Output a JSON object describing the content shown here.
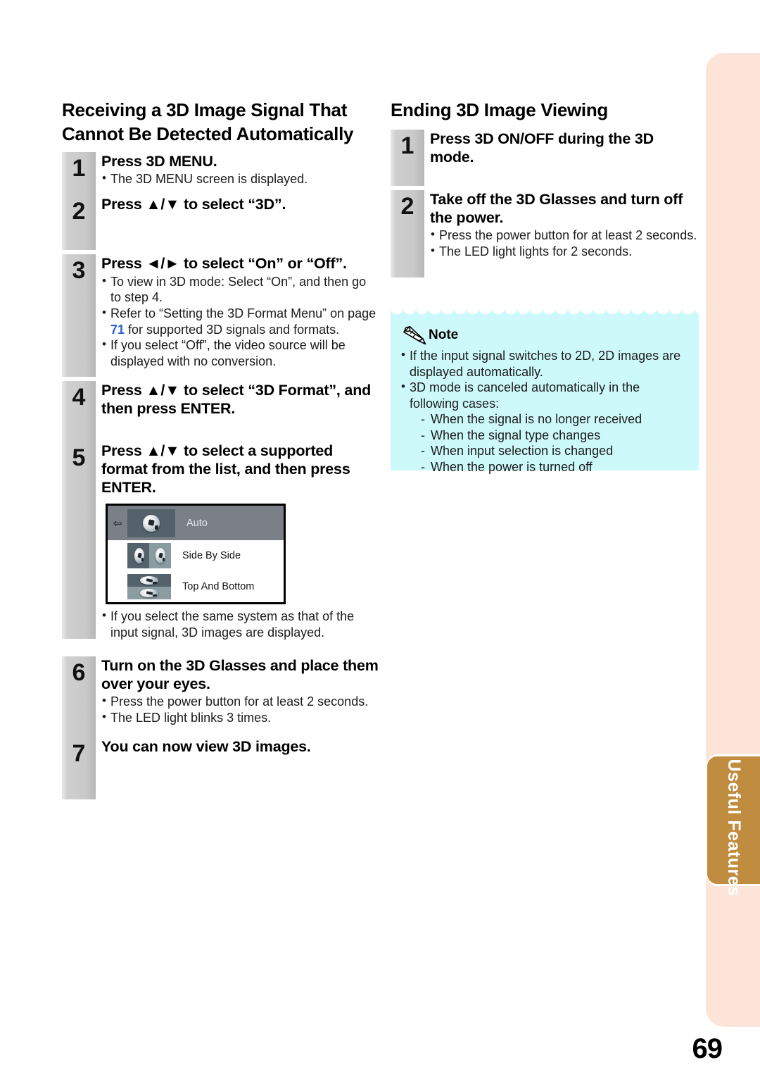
{
  "page": {
    "number": "69",
    "side_tab_label": "Useful Features",
    "colors": {
      "side_panel": "#fce4d8",
      "side_tab": "#c08c3f",
      "note_bg": "#cdf9fb",
      "link": "#2b5fd9",
      "badge_gray": "#c9c9c9"
    }
  },
  "left_column": {
    "heading": "Receiving a 3D Image Signal That Cannot Be Detected Automatically",
    "steps": [
      {
        "number": "1",
        "title_parts": [
          {
            "text": "Press ",
            "bold": true
          },
          {
            "text": "3D MENU",
            "bold": true
          },
          {
            "text": ".",
            "bold": true
          }
        ],
        "title": "Press 3D MENU.",
        "bullets": [
          {
            "text": "The 3D MENU screen is displayed."
          }
        ]
      },
      {
        "number": "2",
        "title": "Press ▲/▼ to select “3D”.",
        "bullets": []
      },
      {
        "number": "3",
        "title": "Press ◄/► to select “On” or “Off”.",
        "bullets": [
          {
            "text": "To view in 3D mode: Select “On”, and then go to step 4."
          },
          {
            "pre": "Refer to “Setting the 3D Format Menu” on page ",
            "link": "71",
            "post": " for supported 3D signals and formats."
          },
          {
            "text": "If you select “Off”, the video source will be displayed with no conversion."
          }
        ]
      },
      {
        "number": "4",
        "title": "Press ▲/▼ to select “3D Format”, and then press ENTER.",
        "bullets": []
      },
      {
        "number": "5",
        "title": "Press ▲/▼ to select a supported format from the list, and then press ENTER.",
        "bullets": [
          {
            "text": "If you select the same system as that of the input signal, 3D images are displayed."
          }
        ]
      },
      {
        "number": "6",
        "title": "Turn on the 3D Glasses and place them over your eyes.",
        "bullets": [
          {
            "text": "Press the power button for at least 2 seconds."
          },
          {
            "text": "The LED light blinks 3 times."
          }
        ]
      },
      {
        "number": "7",
        "title": "You can now view 3D images.",
        "bullets": []
      }
    ],
    "osd_menu": {
      "rows": [
        {
          "label": "Auto",
          "selected": true,
          "thumb": "single-ball"
        },
        {
          "label": "Side By Side",
          "selected": false,
          "thumb": "side-by-side-balls"
        },
        {
          "label": "Top And Bottom",
          "selected": false,
          "thumb": "top-and-bottom-balls"
        }
      ],
      "cursor_glyph": "⇦"
    }
  },
  "right_column": {
    "heading": "Ending 3D Image Viewing",
    "steps": [
      {
        "number": "1",
        "title": "Press 3D ON/OFF during the 3D mode.",
        "bullets": []
      },
      {
        "number": "2",
        "title": "Take off the 3D Glasses and turn off the power.",
        "bullets": [
          {
            "text": "Press the power button for at least 2 seconds."
          },
          {
            "text": "The LED light lights for 2 seconds."
          }
        ]
      }
    ],
    "note": {
      "title": "Note",
      "bullets": [
        {
          "text": "If the input signal switches to 2D, 2D images are displayed automatically."
        },
        {
          "text": "3D mode is canceled automatically in the following cases:"
        }
      ],
      "sub_items": [
        "When the signal is no longer received",
        "When the signal type changes",
        "When input selection is changed",
        "When the power is turned off"
      ]
    }
  }
}
